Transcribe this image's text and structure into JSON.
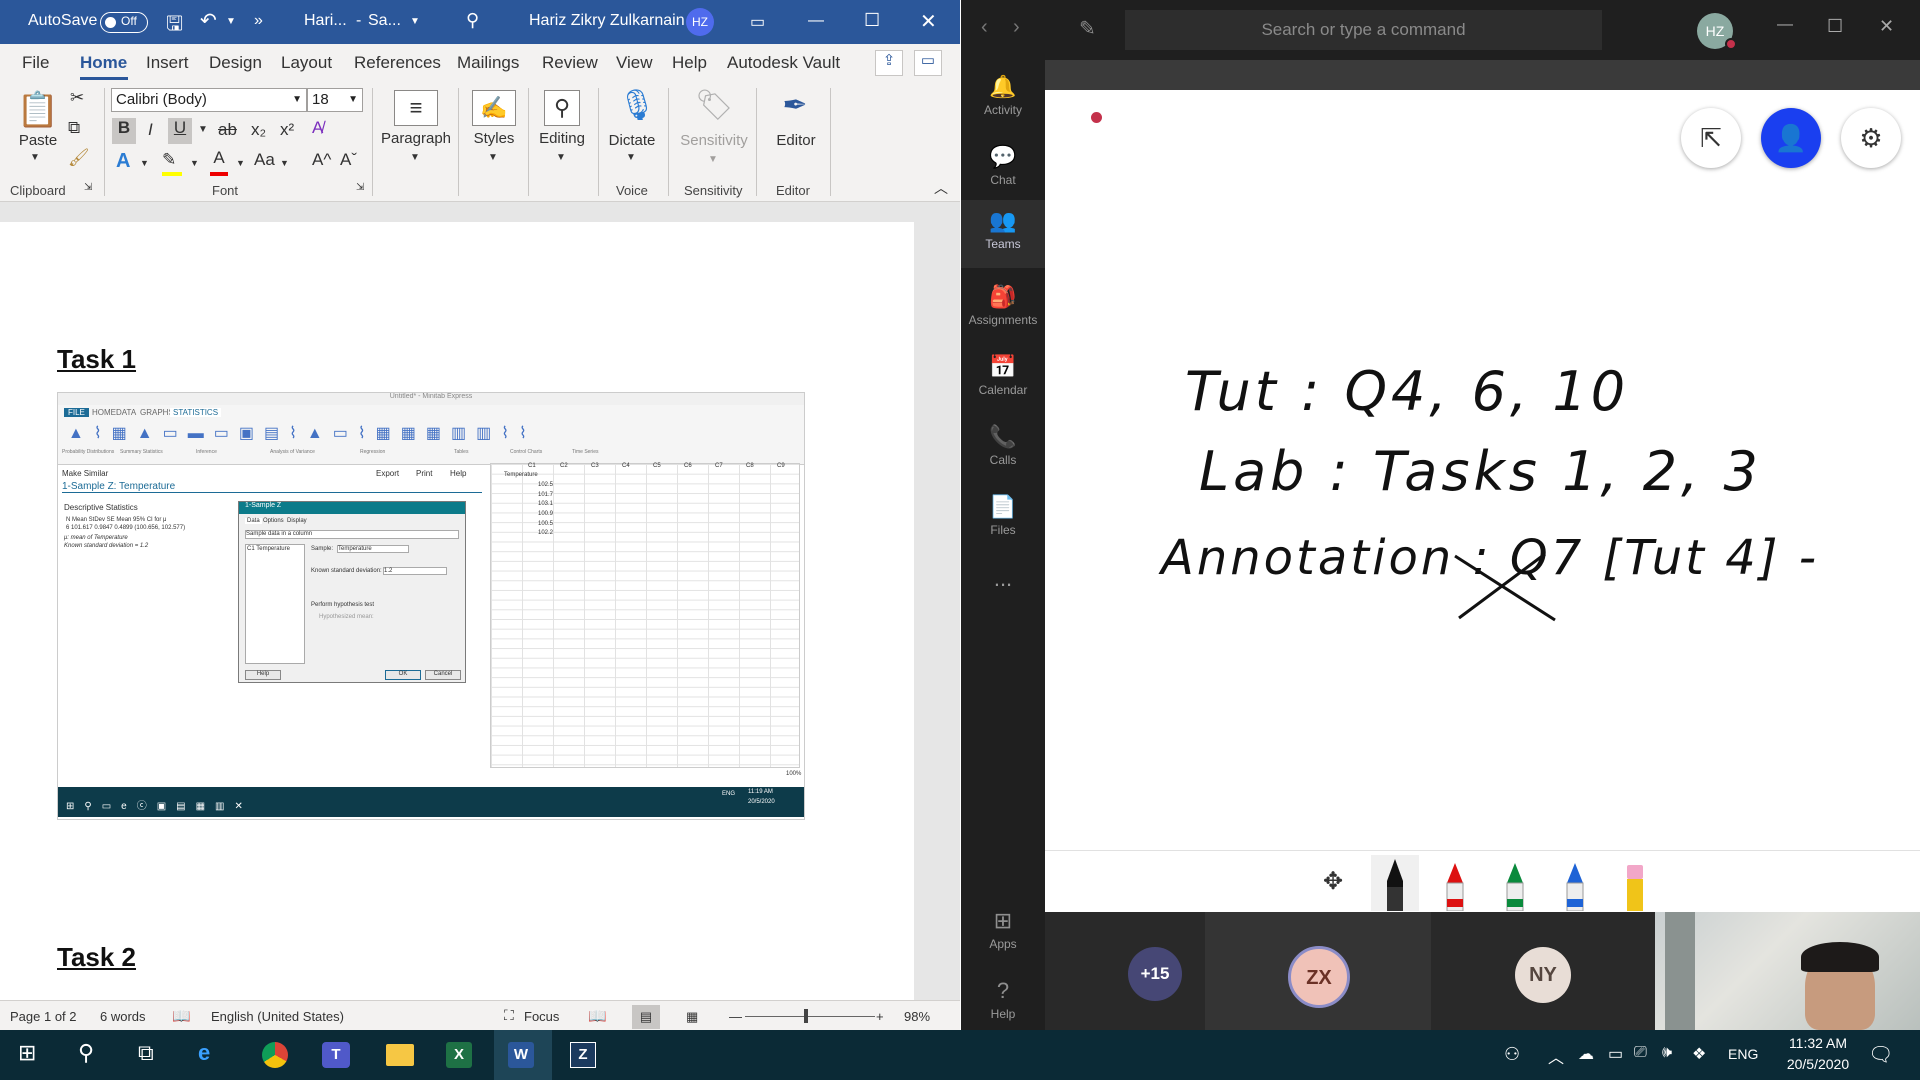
{
  "word": {
    "titlebar": {
      "autosave_label": "AutoSave",
      "autosave_state": "Off",
      "doc_name": "Hari...",
      "sep": "-",
      "save_state": "Sa...",
      "user_name": "Hariz Zikry Zulkarnain",
      "user_initials": "HZ"
    },
    "menu": [
      "File",
      "Home",
      "Insert",
      "Design",
      "Layout",
      "References",
      "Mailings",
      "Review",
      "View",
      "Help",
      "Autodesk Vault"
    ],
    "ribbon": {
      "paste": "Paste",
      "clipboard": "Clipboard",
      "font_name": "Calibri (Body)",
      "font_size": "18",
      "font_group": "Font",
      "paragraph": "Paragraph",
      "styles": "Styles",
      "editing": "Editing",
      "dictate": "Dictate",
      "voice": "Voice",
      "sensitivity_btn": "Sensitivity",
      "sensitivity_group": "Sensitivity",
      "editor_btn": "Editor",
      "editor_group": "Editor",
      "font_buttons": [
        "B",
        "I",
        "U",
        "ab",
        "x₂",
        "x²"
      ],
      "font_buttons2": [
        "A",
        "A",
        "Aa",
        "A^",
        "Aˇ"
      ]
    },
    "document": {
      "heading1": "Task 1",
      "heading2": "Task 2"
    },
    "embedded_screenshot": {
      "window_title": "Untitled* - Minitab Express",
      "tabs": [
        "FILE",
        "HOME",
        "DATA",
        "GRAPHS",
        "STATISTICS"
      ],
      "ribbon_groups": [
        "Probability Distributions",
        "Summary Statistics",
        "Inference",
        "Analysis of Variance",
        "Regression",
        "Tables",
        "Control Charts",
        "Time Series"
      ],
      "make_similar": "Make Similar",
      "export": "Export",
      "print": "Print",
      "help": "Help",
      "output_title": "1-Sample Z: Temperature",
      "desc_title": "Descriptive Statistics",
      "desc_header": "N     Mean    StDev   SE Mean     95% CI for μ",
      "desc_row": "6   101.617   0.9847    0.4899   (100.656, 102.577)",
      "note1": "μ: mean of Temperature",
      "note2": "Known standard deviation = 1.2",
      "dialog_title": "1-Sample Z",
      "dialog_tabs": [
        "Data",
        "Options",
        "Display"
      ],
      "dialog_select": "Sample data in a column",
      "dialog_list_item": "C1 Temperature",
      "sample_label": "Sample:",
      "sample_value": "Temperature",
      "known_sd_label": "Known standard deviation:",
      "known_sd_value": "1.2",
      "perform_test": "Perform hypothesis test",
      "hyp_mean": "Hypothesized mean:",
      "btn_help": "Help",
      "btn_ok": "OK",
      "btn_cancel": "Cancel",
      "col_headers": [
        "C1",
        "C2",
        "C3",
        "C4",
        "C5",
        "C6",
        "C7",
        "C8",
        "C9"
      ],
      "col1_name": "Temperature",
      "col1_values": [
        "102.5",
        "101.7",
        "103.1",
        "100.9",
        "100.5",
        "102.2"
      ],
      "zoom": "100%",
      "clock_time": "11:19 AM",
      "clock_date": "20/5/2020",
      "lang": "ENG"
    },
    "status": {
      "page": "Page 1 of 2",
      "words": "6 words",
      "language": "English (United States)",
      "focus": "Focus",
      "zoom": "98%"
    }
  },
  "teams": {
    "search_placeholder": "Search or type a command",
    "user_initials": "HZ",
    "rail": [
      {
        "label": "Activity",
        "icon": "bell-icon"
      },
      {
        "label": "Chat",
        "icon": "chat-icon"
      },
      {
        "label": "Teams",
        "icon": "teams-icon"
      },
      {
        "label": "Assignments",
        "icon": "assignments-icon"
      },
      {
        "label": "Calendar",
        "icon": "calendar-icon"
      },
      {
        "label": "Calls",
        "icon": "phone-icon"
      },
      {
        "label": "Files",
        "icon": "files-icon"
      }
    ],
    "rail_more": "...",
    "apps": "Apps",
    "help": "Help",
    "whiteboard_lines": [
      "Tut : Q4, 6, 10",
      "Lab : Tasks 1, 2, 3",
      "Annotation : Q7 [Tut 4] -"
    ],
    "participants_more": "+15",
    "participant1": "ZX",
    "participant2": "NY"
  },
  "taskbar": {
    "time": "11:32 AM",
    "date": "20/5/2020",
    "lang": "ENG"
  },
  "colors": {
    "word_blue": "#2b579a",
    "teams_purple": "#6264a7",
    "teams_accent": "#3a3af4",
    "taskbar": "#0b2a36"
  }
}
